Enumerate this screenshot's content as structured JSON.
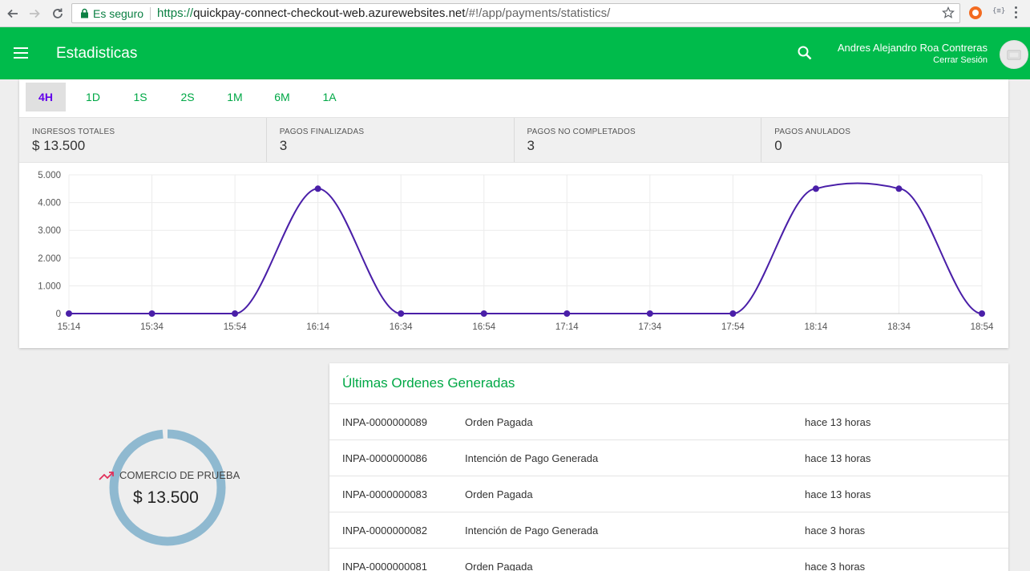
{
  "browser": {
    "secure_label": "Es seguro",
    "url_scheme": "https://",
    "url_host": "quickpay-connect-checkout-web.azurewebsites.net",
    "url_path": "/#!/app/payments/statistics/",
    "ext_label": "{≡}"
  },
  "header": {
    "title": "Estadisticas",
    "user_name": "Andres Alejandro Roa Contreras",
    "logout_label": "Cerrar Sesión"
  },
  "ranges": [
    "4H",
    "1D",
    "1S",
    "2S",
    "1M",
    "6M",
    "1A"
  ],
  "active_range": "4H",
  "metrics": [
    {
      "label": "INGRESOS TOTALES",
      "value": "$ 13.500"
    },
    {
      "label": "PAGOS FINALIZADAS",
      "value": "3"
    },
    {
      "label": "PAGOS NO COMPLETADOS",
      "value": "3"
    },
    {
      "label": "PAGOS ANULADOS",
      "value": "0"
    }
  ],
  "chart_data": {
    "type": "line",
    "x": [
      "15:14",
      "15:34",
      "15:54",
      "16:14",
      "16:34",
      "16:54",
      "17:14",
      "17:34",
      "17:54",
      "18:14",
      "18:34",
      "18:54"
    ],
    "series": [
      {
        "values": [
          0,
          0,
          0,
          4500,
          0,
          0,
          0,
          0,
          0,
          4500,
          4500,
          0
        ]
      }
    ],
    "y_ticks": [
      "0",
      "1.000",
      "2.000",
      "3.000",
      "4.000",
      "5.000"
    ],
    "ylim": [
      0,
      5000
    ],
    "grid": true,
    "color": "#4a1fa8"
  },
  "merchant": {
    "name": "COMERCIO DE PRUEBA",
    "amount": "$ 13.500",
    "ring_color": "#8fb9d0"
  },
  "orders": {
    "title": "Últimas Ordenes Generadas",
    "rows": [
      {
        "id": "INPA-0000000089",
        "status": "Orden Pagada",
        "time": "hace 13 horas"
      },
      {
        "id": "INPA-0000000086",
        "status": "Intención de Pago Generada",
        "time": "hace 13 horas"
      },
      {
        "id": "INPA-0000000083",
        "status": "Orden Pagada",
        "time": "hace 13 horas"
      },
      {
        "id": "INPA-0000000082",
        "status": "Intención de Pago Generada",
        "time": "hace 3 horas"
      },
      {
        "id": "INPA-0000000081",
        "status": "Orden Pagada",
        "time": "hace 3 horas"
      }
    ]
  }
}
